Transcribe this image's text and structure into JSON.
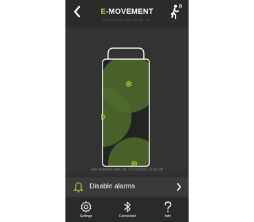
{
  "header": {
    "title_prefix": "E",
    "title_rest": "-MOVEMENT",
    "watermark": "caravaning-shop.sk",
    "back_icon": "chevron-left-icon",
    "right_icon": "walking-person-icon"
  },
  "status": {
    "last_received": "last received data on: 27/07/2022 13:51:28"
  },
  "alarm": {
    "label": "Disable alarms",
    "icon": "bell-icon"
  },
  "tabs": [
    {
      "label": "Settings",
      "icon": "gear-icon"
    },
    {
      "label": "Connected",
      "icon": "bluetooth-icon"
    },
    {
      "label": "Info",
      "icon": "question-icon"
    }
  ],
  "colors": {
    "accent": "#9fd03a",
    "background": "#2e2e2e",
    "sensor_zone": "#4f6b2a"
  }
}
